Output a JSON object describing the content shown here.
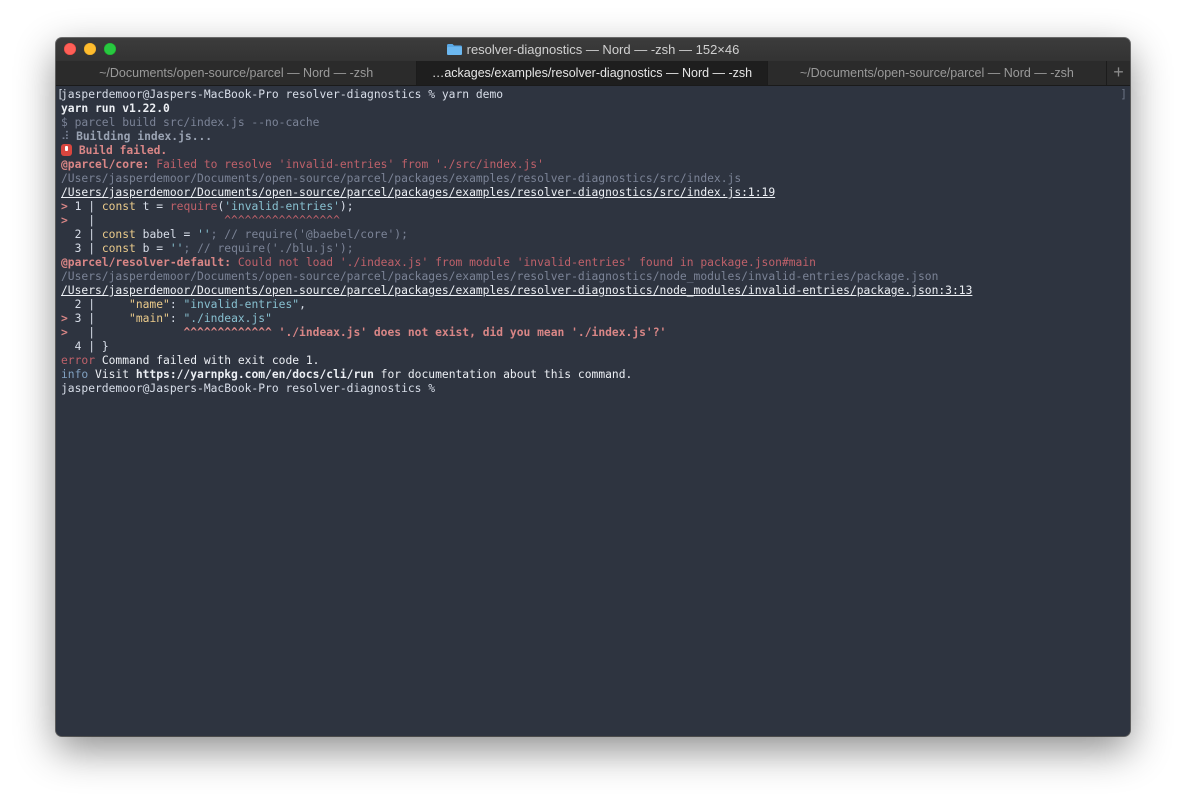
{
  "window": {
    "title": "resolver-diagnostics — Nord — -zsh — 152×46",
    "tabs": [
      {
        "label": "~/Documents/open-source/parcel — Nord — -zsh",
        "active": false
      },
      {
        "label": "…ackages/examples/resolver-diagnostics — Nord — -zsh",
        "active": true
      },
      {
        "label": "~/Documents/open-source/parcel — Nord — -zsh",
        "active": false
      }
    ],
    "add_tab": "+"
  },
  "colors": {
    "background": "#2e3440",
    "foreground": "#d8dee9",
    "error": "#bf616a",
    "string": "#88c0d0",
    "key": "#ebcb8b"
  },
  "terminal": {
    "prompt": "jasperdemoor@Jaspers-MacBook-Pro resolver-diagnostics % ",
    "command": "yarn demo",
    "yarn_run": "yarn run v1.22.0",
    "parcel_cmd": "$ parcel build src/index.js --no-cache",
    "building": "Building index.js...",
    "build_failed": "Build failed.",
    "core_label": "@parcel/core:",
    "core_msg": " Failed to resolve 'invalid-entries' from './src/index.js'",
    "path1": "/Users/jasperdemoor/Documents/open-source/parcel/packages/examples/resolver-diagnostics/src/index.js",
    "path1_loc": "/Users/jasperdemoor/Documents/open-source/parcel/packages/examples/resolver-diagnostics/src/index.js:1:19",
    "code1": {
      "l1_num": "1",
      "l1_kw": "const",
      "l1_mid": " t = ",
      "l1_fn": "require",
      "l1_str": "'invalid-entries'",
      "l1_end": ");",
      "l1_caret": "^^^^^^^^^^^^^^^^^",
      "l2_num": "2",
      "l2_kw": "const",
      "l2_mid": " babel = ",
      "l2_str": "''",
      "l2_comment": "; // require('@baebel/core');",
      "l3_num": "3",
      "l3_kw": "const",
      "l3_mid": " b = ",
      "l3_str": "''",
      "l3_comment": "; // require('./blu.js');"
    },
    "resolver_label": "@parcel/resolver-default:",
    "resolver_msg": " Could not load './indeax.js' from module 'invalid-entries' found in package.json#main",
    "path2": "/Users/jasperdemoor/Documents/open-source/parcel/packages/examples/resolver-diagnostics/node_modules/invalid-entries/package.json",
    "path2_loc": "/Users/jasperdemoor/Documents/open-source/parcel/packages/examples/resolver-diagnostics/node_modules/invalid-entries/package.json:3:13",
    "code2": {
      "l2_num": "2",
      "l2_key": "\"name\"",
      "l2_val": "\"invalid-entries\"",
      "l3_num": "3",
      "l3_key": "\"main\"",
      "l3_val": "\"./indeax.js\"",
      "caret": "^^^^^^^^^^^^^ './indeax.js' does not exist, did you mean './index.js'?'",
      "l4_num": "4",
      "l4_text": "}"
    },
    "error_label": "error",
    "error_msg": " Command failed with exit code 1.",
    "info_label": "info",
    "info_pre": " Visit ",
    "info_url": "https://yarnpkg.com/en/docs/cli/run",
    "info_post": " for documentation about this command.",
    "final_prompt": "jasperdemoor@Jaspers-MacBook-Pro resolver-diagnostics % "
  }
}
